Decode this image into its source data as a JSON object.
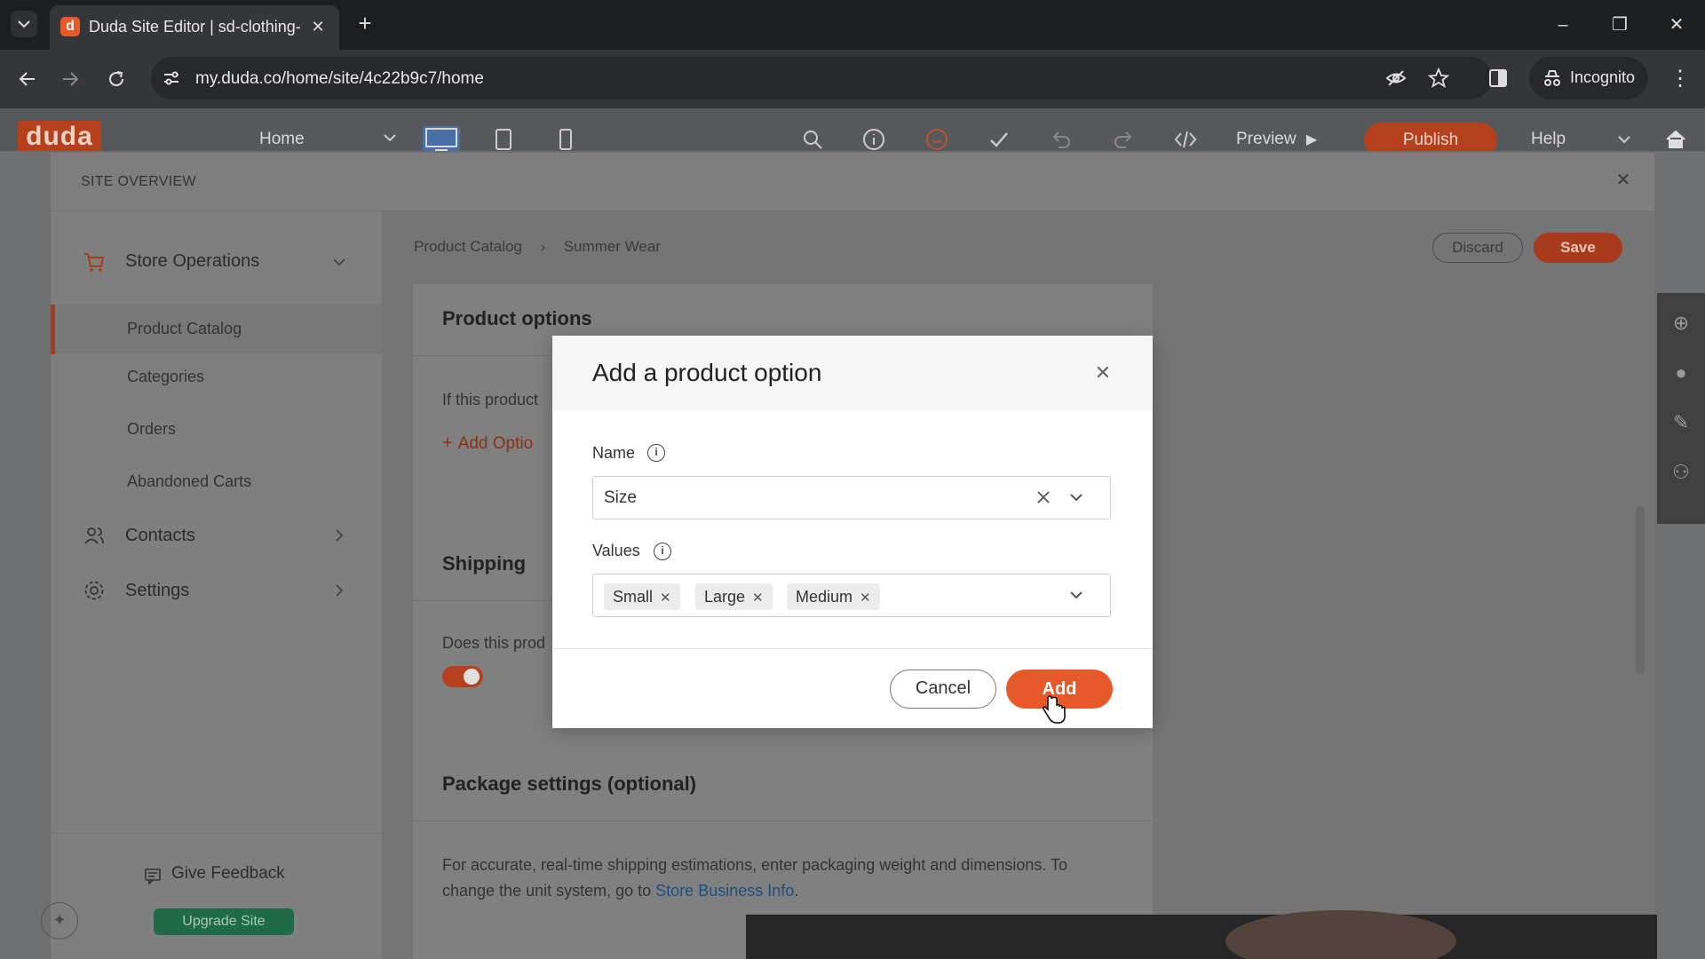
{
  "browser": {
    "tab_title": "Duda Site Editor | sd-clothing-s",
    "url": "my.duda.co/home/site/4c22b9c7/home",
    "incognito_label": "Incognito"
  },
  "editor_header": {
    "logo": "duda",
    "page_selector": "Home",
    "preview_label": "Preview",
    "publish_label": "Publish",
    "help_label": "Help"
  },
  "overview": {
    "title": "SITE OVERVIEW"
  },
  "sidebar": {
    "store_operations": "Store Operations",
    "product_catalog": "Product Catalog",
    "categories": "Categories",
    "orders": "Orders",
    "abandoned_carts": "Abandoned Carts",
    "contacts": "Contacts",
    "settings": "Settings",
    "give_feedback": "Give Feedback",
    "upgrade_site": "Upgrade Site"
  },
  "breadcrumb": {
    "parent": "Product Catalog",
    "current": "Summer Wear"
  },
  "actions": {
    "discard": "Discard",
    "save": "Save"
  },
  "product_page": {
    "options_heading": "Product options",
    "options_text": "If this product",
    "add_option_link": "Add Optio",
    "shipping_heading": "Shipping",
    "shipping_text": "Does this prod",
    "package_heading": "Package settings (optional)",
    "package_text_1": "For accurate, real-time shipping estimations, enter packaging weight and dimensions. To",
    "package_text_2": "change the unit system, go to",
    "package_link": "Store Business Info",
    "package_text_end": "."
  },
  "modal": {
    "title": "Add a product option",
    "name_label": "Name",
    "name_value": "Size",
    "values_label": "Values",
    "values": [
      "Small",
      "Large",
      "Medium"
    ],
    "cancel": "Cancel",
    "add": "Add"
  }
}
